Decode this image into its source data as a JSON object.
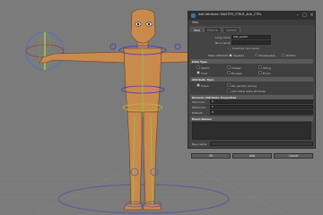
{
  "dialog": {
    "title": "Add Attribute: MASTER_CTRLR_Arm_CTRL",
    "menu_label": "Help",
    "tabs": [
      "New",
      "Particle",
      "Control"
    ],
    "long_name_label": "Long name:",
    "long_name_value": "ikfk_switch",
    "nice_name_label": "Nice name:",
    "override_nice_name_label": "Override nice name",
    "make_attribute_label": "Make attribute:",
    "keyable_label": "Keyable",
    "displayable_label": "Displayable",
    "hidden_label": "Hidden",
    "data_type_header": "Data Type",
    "data_types": [
      "Vector",
      "Integer",
      "String",
      "Float",
      "Boolean",
      "Enum"
    ],
    "attribute_type_header": "Attribute Type",
    "attribute_types": [
      "Scalar",
      "Per particle (array)",
      "Add initial state attribute"
    ],
    "numeric_header": "Numeric Attribute Properties",
    "numeric_labels": [
      "Minimum:",
      "Maximum:",
      "Default:"
    ],
    "numeric_values": [
      "0",
      "1",
      "0"
    ],
    "enum_header": "Enum Names",
    "new_name_label": "New name:",
    "buttons": [
      "OK",
      "Add",
      "Cancel"
    ]
  },
  "colors": {
    "viewport_bg": "#7b7b7b",
    "character_skin": "#c98a4e",
    "selection_green": "#7fd44a",
    "dialog_bg": "#444444"
  }
}
